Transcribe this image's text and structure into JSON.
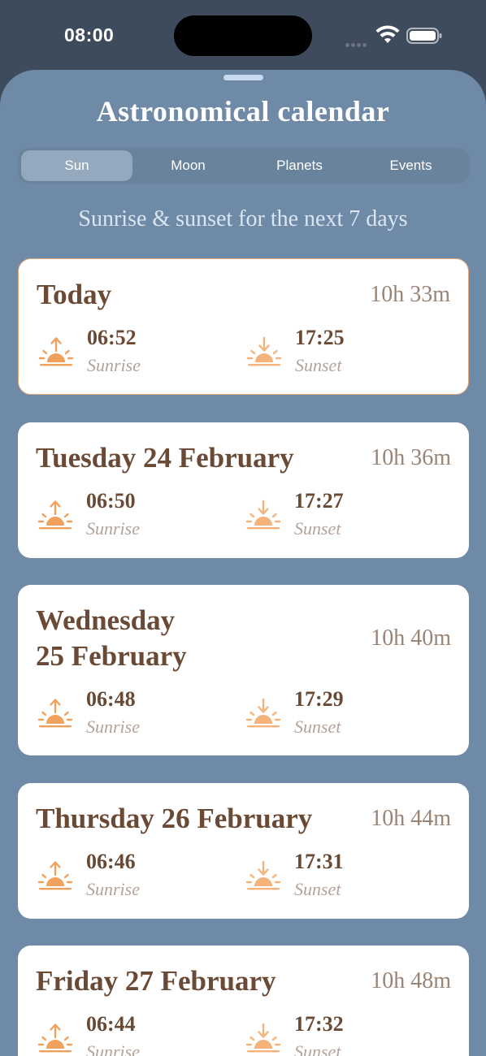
{
  "status_bar": {
    "time": "08:00"
  },
  "sheet": {
    "title": "Astronomical calendar",
    "tabs": [
      {
        "label": "Sun",
        "active": true
      },
      {
        "label": "Moon",
        "active": false
      },
      {
        "label": "Planets",
        "active": false
      },
      {
        "label": "Events",
        "active": false
      }
    ],
    "subtitle": "Sunrise & sunset for the next 7 days"
  },
  "days": [
    {
      "title": "Today",
      "duration": "10h 33m",
      "sunrise": "06:52",
      "sunset": "17:25",
      "sunrise_label": "Sunrise",
      "sunset_label": "Sunset"
    },
    {
      "title": "Tuesday 24 February",
      "duration": "10h 36m",
      "sunrise": "06:50",
      "sunset": "17:27",
      "sunrise_label": "Sunrise",
      "sunset_label": "Sunset"
    },
    {
      "title_line1": "Wednesday",
      "title_line2": "25 February",
      "duration": "10h 40m",
      "sunrise": "06:48",
      "sunset": "17:29",
      "sunrise_label": "Sunrise",
      "sunset_label": "Sunset"
    },
    {
      "title": "Thursday 26 February",
      "duration": "10h 44m",
      "sunrise": "06:46",
      "sunset": "17:31",
      "sunrise_label": "Sunrise",
      "sunset_label": "Sunset"
    },
    {
      "title": "Friday 27 February",
      "duration": "10h 48m",
      "sunrise": "06:44",
      "sunset": "17:32",
      "sunrise_label": "Sunrise",
      "sunset_label": "Sunset"
    }
  ],
  "colors": {
    "accent_orange": "#f0a05a",
    "brown": "#6a4a35",
    "sheet_bg": "#6f8aa6"
  },
  "icons": {
    "sunrise": "sunrise-icon",
    "sunset": "sunset-icon"
  }
}
